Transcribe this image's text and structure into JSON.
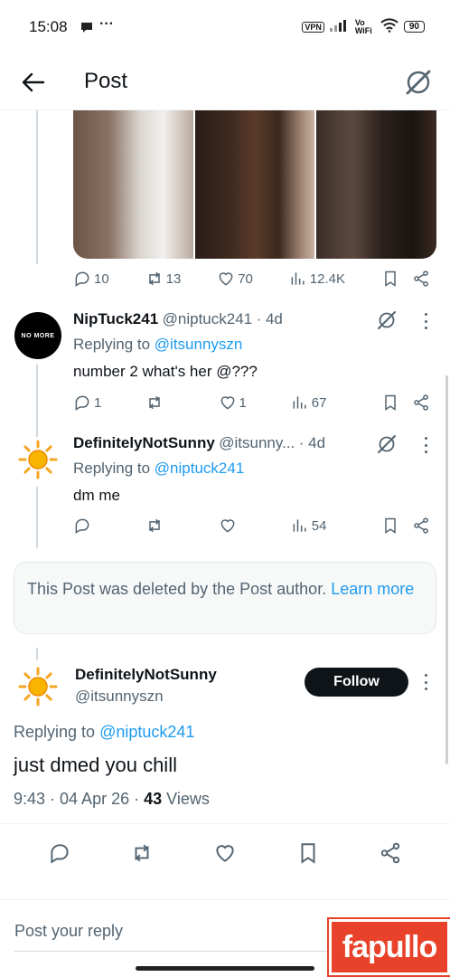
{
  "status_bar": {
    "time": "15:08",
    "vpn": "VPN",
    "wifi_label": "Vo WiFi",
    "battery": "90"
  },
  "header": {
    "title": "Post",
    "back_icon": "arrow-left-icon",
    "grok_icon": "grok-icon"
  },
  "media_post": {
    "stats": {
      "replies": "10",
      "reposts": "13",
      "likes": "70",
      "views": "12.4K"
    }
  },
  "replies": [
    {
      "name": "NipTuck241",
      "handle": "@niptuck241",
      "time": "· 4d",
      "replying_prefix": "Replying to",
      "replying_to": "@itsunnyszn",
      "text": "number 2 what's her @???",
      "avatar_text": "NO MORE",
      "stats": {
        "replies": "1",
        "reposts": "",
        "likes": "1",
        "views": "67"
      }
    },
    {
      "name": "DefinitelyNotSunny",
      "handle": "@itsunny...",
      "time": "· 4d",
      "replying_prefix": "Replying to",
      "replying_to": "@niptuck241",
      "text": "dm me",
      "stats": {
        "replies": "",
        "reposts": "",
        "likes": "",
        "views": "54"
      }
    }
  ],
  "deleted_notice": {
    "text": "This Post was deleted by the Post author.",
    "link": "Learn more"
  },
  "main_post": {
    "name": "DefinitelyNotSunny",
    "handle": "@itsunnyszn",
    "follow_label": "Follow",
    "replying_prefix": "Replying to",
    "replying_to": "@niptuck241",
    "text": "just dmed you chill",
    "meta_time": "9:43 · 04 Apr 26 ·",
    "views_count": "43",
    "views_label": "Views"
  },
  "reply_bar": {
    "placeholder": "Post your reply"
  },
  "watermark": {
    "text": "fapullo"
  },
  "colors": {
    "accent": "#1d9bf0",
    "text": "#0f1419",
    "muted": "#536471",
    "follow_bg": "#0f1419",
    "watermark_bg": "#e8432a"
  }
}
